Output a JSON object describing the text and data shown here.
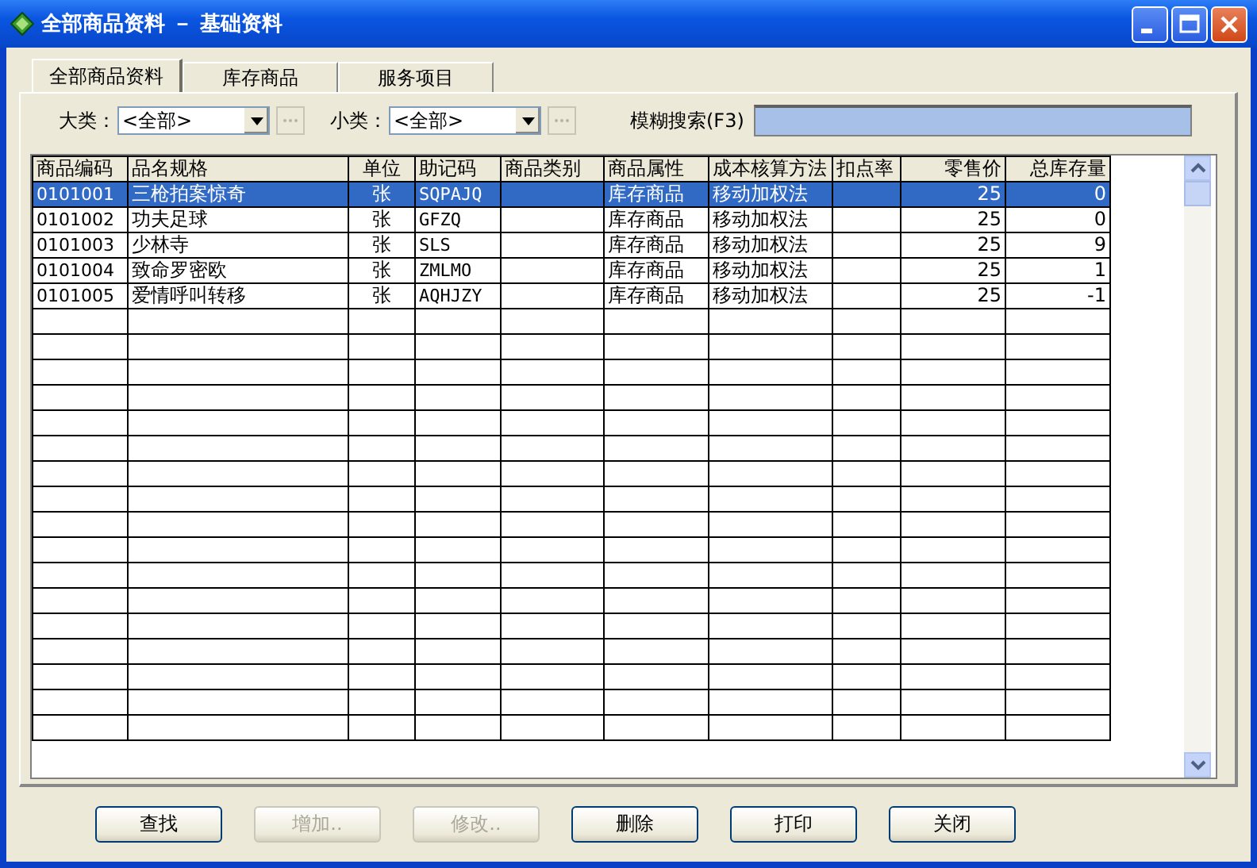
{
  "window": {
    "title": "全部商品资料 － 基础资料"
  },
  "tabs": [
    {
      "label": "全部商品资料",
      "selected": true
    },
    {
      "label": "库存商品",
      "selected": false
    },
    {
      "label": "服务项目",
      "selected": false
    }
  ],
  "filters": [
    {
      "label": "大类：",
      "value": "<全部>"
    },
    {
      "label": "小类：",
      "value": "<全部>"
    }
  ],
  "search": {
    "label": "模糊搜索(F3)"
  },
  "table": {
    "columns": [
      "商品编码",
      "品名规格",
      "单位",
      "助记码",
      "商品类别",
      "商品属性",
      "成本核算方法",
      "扣点率",
      "零售价",
      "总库存量"
    ],
    "rows": [
      {
        "selected": true,
        "cells": [
          "0101001",
          "三枪拍案惊奇",
          "张",
          "SQPAJQ",
          "",
          "库存商品",
          "移动加权法",
          "",
          "25",
          "0"
        ]
      },
      {
        "selected": false,
        "cells": [
          "0101002",
          "功夫足球",
          "张",
          "GFZQ",
          "",
          "库存商品",
          "移动加权法",
          "",
          "25",
          "0"
        ]
      },
      {
        "selected": false,
        "cells": [
          "0101003",
          "少林寺",
          "张",
          "SLS",
          "",
          "库存商品",
          "移动加权法",
          "",
          "25",
          "9"
        ]
      },
      {
        "selected": false,
        "cells": [
          "0101004",
          "致命罗密欧",
          "张",
          "ZMLMO",
          "",
          "库存商品",
          "移动加权法",
          "",
          "25",
          "1"
        ]
      },
      {
        "selected": false,
        "cells": [
          "0101005",
          "爱情呼叫转移",
          "张",
          "AQHJZY",
          "",
          "库存商品",
          "移动加权法",
          "",
          "25",
          "-1"
        ]
      }
    ]
  },
  "buttons": [
    {
      "label": "查找",
      "disabled": false
    },
    {
      "label": "增加..",
      "disabled": true
    },
    {
      "label": "修改..",
      "disabled": true
    },
    {
      "label": "删除",
      "disabled": false
    },
    {
      "label": "打印",
      "disabled": false
    },
    {
      "label": "关闭",
      "disabled": false
    }
  ]
}
